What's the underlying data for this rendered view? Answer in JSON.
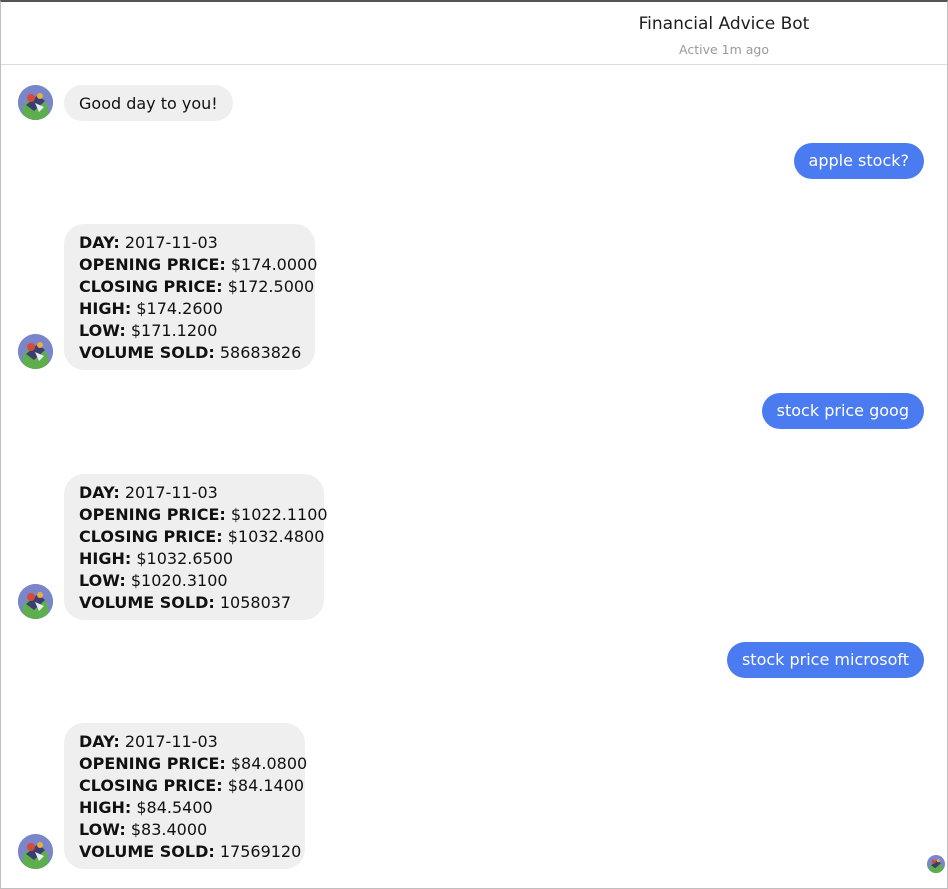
{
  "header": {
    "title": "Financial Advice Bot",
    "status": "Active 1m ago"
  },
  "messages": [
    {
      "from": "bot",
      "type": "text",
      "text": "Good day to you!"
    },
    {
      "from": "user",
      "text": "apple stock?"
    },
    {
      "from": "bot",
      "type": "card",
      "fields": [
        {
          "label": "DAY:",
          "value": "2017-11-03"
        },
        {
          "label": "OPENING PRICE:",
          "value": "$174.0000"
        },
        {
          "label": "CLOSING PRICE:",
          "value": "$172.5000"
        },
        {
          "label": "HIGH:",
          "value": "$174.2600"
        },
        {
          "label": "LOW:",
          "value": "$171.1200"
        },
        {
          "label": "VOLUME SOLD:",
          "value": "58683826"
        }
      ]
    },
    {
      "from": "user",
      "text": "stock price goog"
    },
    {
      "from": "bot",
      "type": "card",
      "fields": [
        {
          "label": "DAY:",
          "value": "2017-11-03"
        },
        {
          "label": "OPENING PRICE:",
          "value": "$1022.1100"
        },
        {
          "label": "CLOSING PRICE:",
          "value": "$1032.4800"
        },
        {
          "label": "HIGH:",
          "value": "$1032.6500"
        },
        {
          "label": "LOW:",
          "value": "$1020.3100"
        },
        {
          "label": "VOLUME SOLD:",
          "value": "1058037"
        }
      ]
    },
    {
      "from": "user",
      "text": "stock price microsoft"
    },
    {
      "from": "bot",
      "type": "card",
      "fields": [
        {
          "label": "DAY:",
          "value": "2017-11-03"
        },
        {
          "label": "OPENING PRICE:",
          "value": "$84.0800"
        },
        {
          "label": "CLOSING PRICE:",
          "value": "$84.1400"
        },
        {
          "label": "HIGH:",
          "value": "$84.5400"
        },
        {
          "label": "LOW:",
          "value": "$83.4000"
        },
        {
          "label": "VOLUME SOLD:",
          "value": "17569120"
        }
      ]
    }
  ],
  "colors": {
    "user_bubble": "#4b7bf0",
    "bot_bubble": "#efefef"
  },
  "icons": {
    "bot_avatar": "bot-avatar-icon",
    "seen_indicator": "seen-avatar-icon"
  }
}
